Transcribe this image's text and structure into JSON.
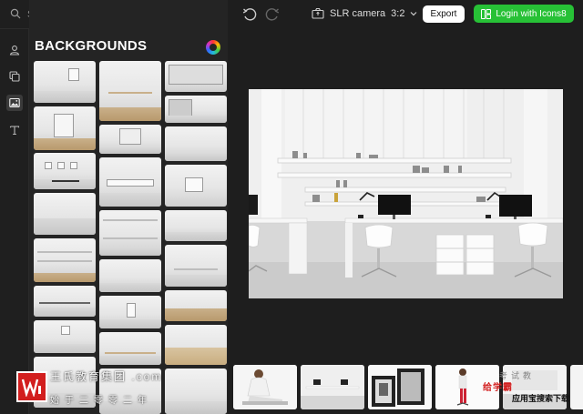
{
  "search": {
    "placeholder": "Search..."
  },
  "panel": {
    "title": "BACKGROUNDS"
  },
  "topbar": {
    "camera_label": "SLR camera",
    "aspect_ratio": "3:2",
    "export_label": "Export",
    "login_label": "Login with Icons8"
  },
  "rail": {
    "items": [
      {
        "icon": "person-icon",
        "active": false
      },
      {
        "icon": "layers-icon",
        "active": false
      },
      {
        "icon": "image-icon",
        "active": true
      },
      {
        "icon": "text-icon",
        "active": false
      }
    ]
  },
  "watermark": {
    "line1": "王氏教育集团 .com",
    "line2": "始于二零零二年",
    "line3": "给学霸",
    "line4": "应用宝搜索下载",
    "line5": "考试教"
  },
  "colors": {
    "accent_green": "#27c136",
    "background": "#1e1e1e",
    "panel": "#242424",
    "watermark_red": "#d21e1e"
  }
}
